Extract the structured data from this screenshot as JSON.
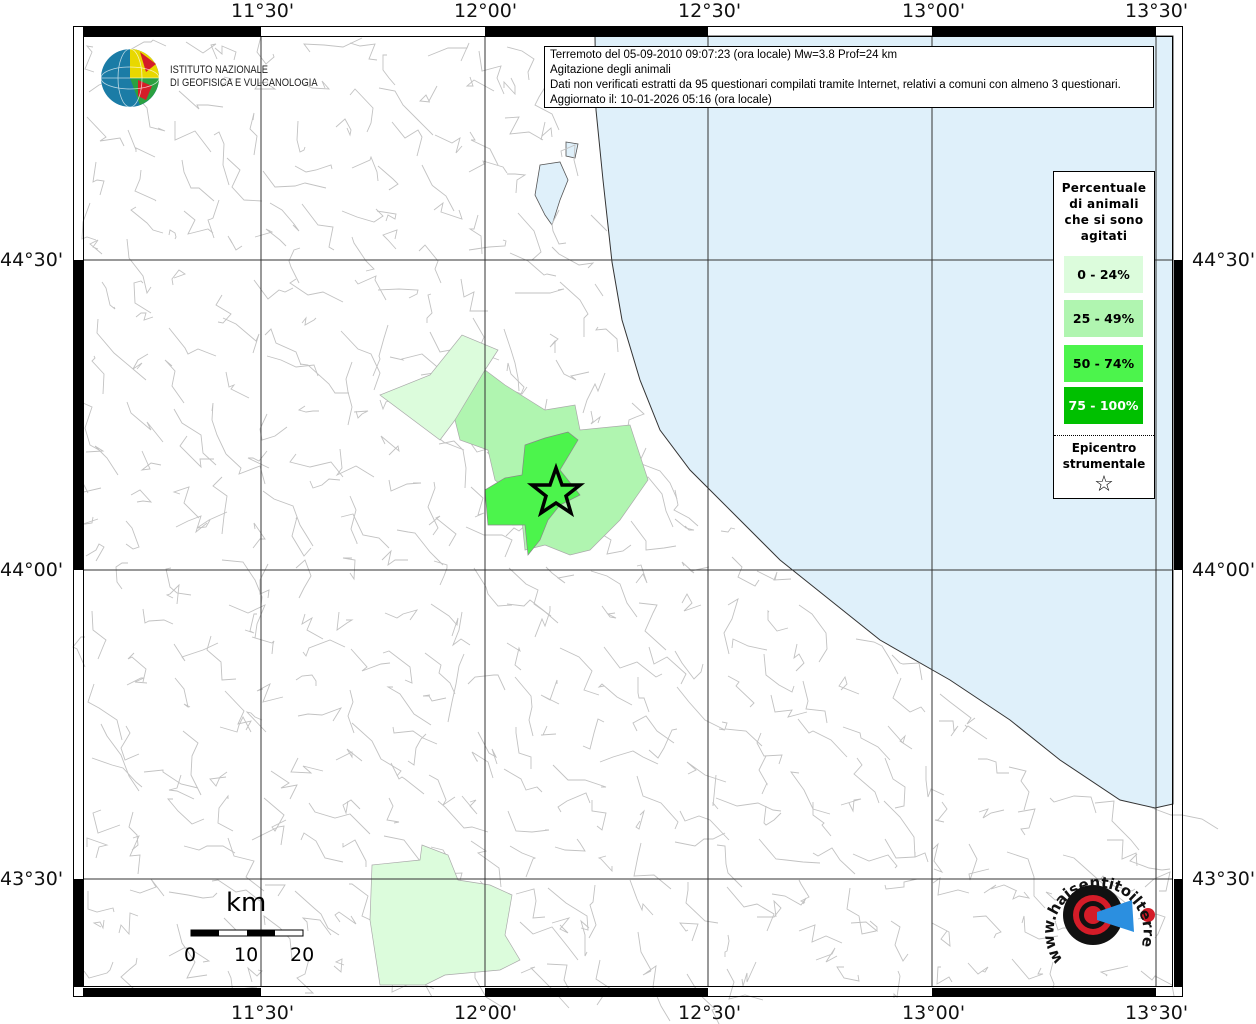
{
  "info": {
    "line1": "Terremoto del 05-09-2010 09:07:23 (ora locale) Mw=3.8 Prof=24 km",
    "line2": "Agitazione degli animali",
    "line3": "Dati non verificati estratti da 95 questionari compilati tramite Internet, relativi a comuni con almeno 3 questionari.",
    "line4": "Aggiornato il: 10-01-2026 05:16 (ora locale)"
  },
  "logo_ingv": {
    "line1": "ISTITUTO NAZIONALE",
    "line2": "DI GEOFISICA E VULCANOLOGIA"
  },
  "logo_hsit": {
    "text": "www.haisentitoilterremoto.it"
  },
  "axes": {
    "lon": [
      "11°30'",
      "12°00'",
      "12°30'",
      "13°00'",
      "13°30'"
    ],
    "lat": [
      "44°30'",
      "44°00'",
      "43°30'"
    ]
  },
  "legend": {
    "title_lines": [
      "Percentuale",
      "di animali",
      "che si sono",
      "agitati"
    ],
    "classes": [
      {
        "label": "0 - 24%",
        "color": "#dcfcdc"
      },
      {
        "label": "25 - 49%",
        "color": "#b0f5b0"
      },
      {
        "label": "50 - 74%",
        "color": "#4cf44c"
      },
      {
        "label": "75 - 100%",
        "color": "#00c000"
      }
    ],
    "epicenter_lines": [
      "Epicentro",
      "strumentale"
    ],
    "epicenter_symbol": "☆"
  },
  "scale": {
    "unit": "km",
    "ticks": [
      "0",
      "10",
      "20"
    ]
  },
  "colors": {
    "sea": "#dff0fa",
    "borders": "#bdbdbd",
    "grid": "#333333"
  }
}
